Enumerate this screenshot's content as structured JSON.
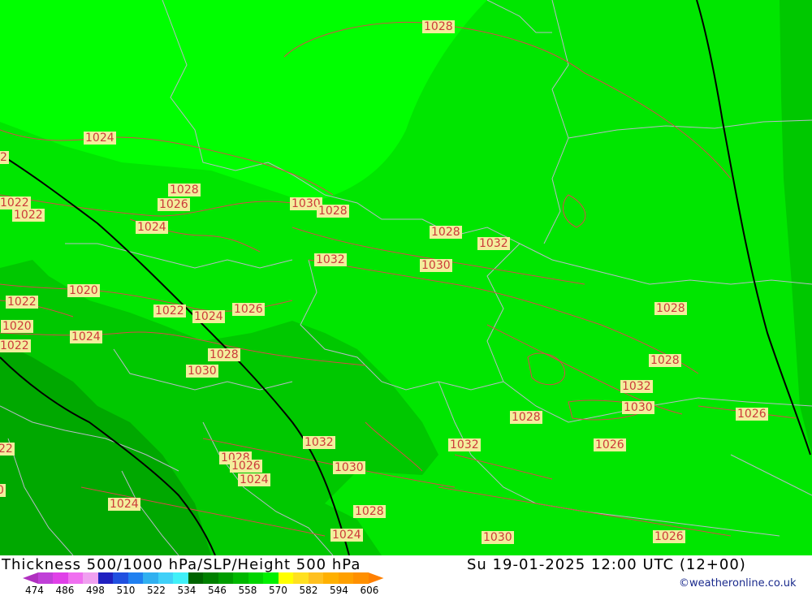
{
  "footer": {
    "title": "Thickness 500/1000 hPa/SLP/Height 500 hPa",
    "datetime": "Su 19-01-2025 12:00 UTC (12+00)",
    "credit": "©weatheronline.co.uk"
  },
  "colorbar": {
    "colors": [
      "#b030c0",
      "#c040d8",
      "#e040e8",
      "#f070f0",
      "#f0a0f0",
      "#2020c0",
      "#2050e0",
      "#2080f0",
      "#30b0f0",
      "#40d0f8",
      "#40f0f8",
      "#006400",
      "#008000",
      "#009c00",
      "#00b800",
      "#00d400",
      "#00f000",
      "#ffff00",
      "#ffe020",
      "#ffc020",
      "#ffb000",
      "#ffa000",
      "#ff9000",
      "#ff8000"
    ],
    "ticks": [
      "474",
      "486",
      "498",
      "510",
      "522",
      "534",
      "546",
      "558",
      "570",
      "582",
      "594",
      "606"
    ]
  },
  "map": {
    "colors": {
      "light_green": "#00ff00",
      "mid_green": "#00e600",
      "dark_green": "#00c800",
      "darker_green": "#00a800",
      "isobar": "#d84a4a",
      "border": "#b9b9c8",
      "height_line": "#000000"
    },
    "isobar_labels": [
      {
        "text": "1028"
      },
      {
        "text": "1024"
      },
      {
        "text": "2"
      },
      {
        "text": "1022"
      },
      {
        "text": "1022"
      },
      {
        "text": "1028"
      },
      {
        "text": "1026"
      },
      {
        "text": "1030"
      },
      {
        "text": "1028"
      },
      {
        "text": "1024"
      },
      {
        "text": "1028"
      },
      {
        "text": "1032"
      },
      {
        "text": "1032"
      },
      {
        "text": "1030"
      },
      {
        "text": "1020"
      },
      {
        "text": "1022"
      },
      {
        "text": "1022"
      },
      {
        "text": "1024"
      },
      {
        "text": "1026"
      },
      {
        "text": "1028"
      },
      {
        "text": "1020"
      },
      {
        "text": "1024"
      },
      {
        "text": "1022"
      },
      {
        "text": "1028"
      },
      {
        "text": "1030"
      },
      {
        "text": "1028"
      },
      {
        "text": "1032"
      },
      {
        "text": "1030"
      },
      {
        "text": "1028"
      },
      {
        "text": "1026"
      },
      {
        "text": "1026"
      },
      {
        "text": "1032"
      },
      {
        "text": "1032"
      },
      {
        "text": "22"
      },
      {
        "text": "1028"
      },
      {
        "text": "1026"
      },
      {
        "text": "1024"
      },
      {
        "text": "1030"
      },
      {
        "text": "0"
      },
      {
        "text": "1024"
      },
      {
        "text": "1028"
      },
      {
        "text": "1024"
      },
      {
        "text": "1030"
      },
      {
        "text": "1026"
      }
    ]
  }
}
